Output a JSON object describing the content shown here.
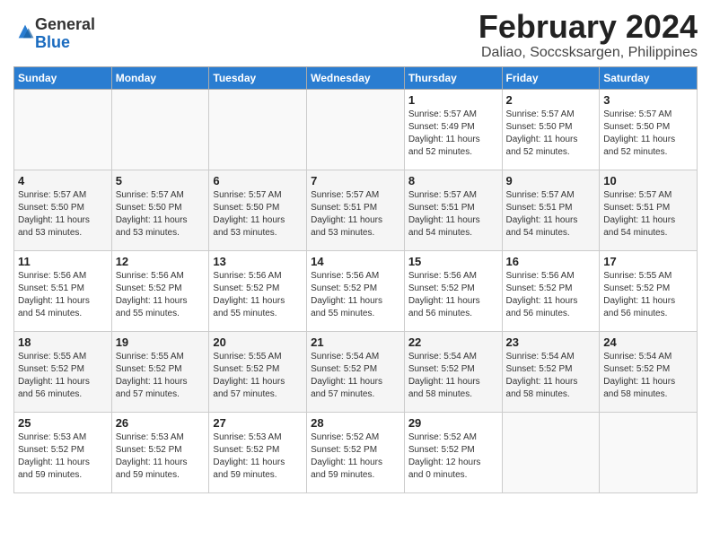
{
  "header": {
    "logo_general": "General",
    "logo_blue": "Blue",
    "month": "February 2024",
    "location": "Daliao, Soccsksargen, Philippines"
  },
  "columns": [
    "Sunday",
    "Monday",
    "Tuesday",
    "Wednesday",
    "Thursday",
    "Friday",
    "Saturday"
  ],
  "weeks": [
    [
      {
        "day": "",
        "content": ""
      },
      {
        "day": "",
        "content": ""
      },
      {
        "day": "",
        "content": ""
      },
      {
        "day": "",
        "content": ""
      },
      {
        "day": "1",
        "content": "Sunrise: 5:57 AM\nSunset: 5:49 PM\nDaylight: 11 hours\nand 52 minutes."
      },
      {
        "day": "2",
        "content": "Sunrise: 5:57 AM\nSunset: 5:50 PM\nDaylight: 11 hours\nand 52 minutes."
      },
      {
        "day": "3",
        "content": "Sunrise: 5:57 AM\nSunset: 5:50 PM\nDaylight: 11 hours\nand 52 minutes."
      }
    ],
    [
      {
        "day": "4",
        "content": "Sunrise: 5:57 AM\nSunset: 5:50 PM\nDaylight: 11 hours\nand 53 minutes."
      },
      {
        "day": "5",
        "content": "Sunrise: 5:57 AM\nSunset: 5:50 PM\nDaylight: 11 hours\nand 53 minutes."
      },
      {
        "day": "6",
        "content": "Sunrise: 5:57 AM\nSunset: 5:50 PM\nDaylight: 11 hours\nand 53 minutes."
      },
      {
        "day": "7",
        "content": "Sunrise: 5:57 AM\nSunset: 5:51 PM\nDaylight: 11 hours\nand 53 minutes."
      },
      {
        "day": "8",
        "content": "Sunrise: 5:57 AM\nSunset: 5:51 PM\nDaylight: 11 hours\nand 54 minutes."
      },
      {
        "day": "9",
        "content": "Sunrise: 5:57 AM\nSunset: 5:51 PM\nDaylight: 11 hours\nand 54 minutes."
      },
      {
        "day": "10",
        "content": "Sunrise: 5:57 AM\nSunset: 5:51 PM\nDaylight: 11 hours\nand 54 minutes."
      }
    ],
    [
      {
        "day": "11",
        "content": "Sunrise: 5:56 AM\nSunset: 5:51 PM\nDaylight: 11 hours\nand 54 minutes."
      },
      {
        "day": "12",
        "content": "Sunrise: 5:56 AM\nSunset: 5:52 PM\nDaylight: 11 hours\nand 55 minutes."
      },
      {
        "day": "13",
        "content": "Sunrise: 5:56 AM\nSunset: 5:52 PM\nDaylight: 11 hours\nand 55 minutes."
      },
      {
        "day": "14",
        "content": "Sunrise: 5:56 AM\nSunset: 5:52 PM\nDaylight: 11 hours\nand 55 minutes."
      },
      {
        "day": "15",
        "content": "Sunrise: 5:56 AM\nSunset: 5:52 PM\nDaylight: 11 hours\nand 56 minutes."
      },
      {
        "day": "16",
        "content": "Sunrise: 5:56 AM\nSunset: 5:52 PM\nDaylight: 11 hours\nand 56 minutes."
      },
      {
        "day": "17",
        "content": "Sunrise: 5:55 AM\nSunset: 5:52 PM\nDaylight: 11 hours\nand 56 minutes."
      }
    ],
    [
      {
        "day": "18",
        "content": "Sunrise: 5:55 AM\nSunset: 5:52 PM\nDaylight: 11 hours\nand 56 minutes."
      },
      {
        "day": "19",
        "content": "Sunrise: 5:55 AM\nSunset: 5:52 PM\nDaylight: 11 hours\nand 57 minutes."
      },
      {
        "day": "20",
        "content": "Sunrise: 5:55 AM\nSunset: 5:52 PM\nDaylight: 11 hours\nand 57 minutes."
      },
      {
        "day": "21",
        "content": "Sunrise: 5:54 AM\nSunset: 5:52 PM\nDaylight: 11 hours\nand 57 minutes."
      },
      {
        "day": "22",
        "content": "Sunrise: 5:54 AM\nSunset: 5:52 PM\nDaylight: 11 hours\nand 58 minutes."
      },
      {
        "day": "23",
        "content": "Sunrise: 5:54 AM\nSunset: 5:52 PM\nDaylight: 11 hours\nand 58 minutes."
      },
      {
        "day": "24",
        "content": "Sunrise: 5:54 AM\nSunset: 5:52 PM\nDaylight: 11 hours\nand 58 minutes."
      }
    ],
    [
      {
        "day": "25",
        "content": "Sunrise: 5:53 AM\nSunset: 5:52 PM\nDaylight: 11 hours\nand 59 minutes."
      },
      {
        "day": "26",
        "content": "Sunrise: 5:53 AM\nSunset: 5:52 PM\nDaylight: 11 hours\nand 59 minutes."
      },
      {
        "day": "27",
        "content": "Sunrise: 5:53 AM\nSunset: 5:52 PM\nDaylight: 11 hours\nand 59 minutes."
      },
      {
        "day": "28",
        "content": "Sunrise: 5:52 AM\nSunset: 5:52 PM\nDaylight: 11 hours\nand 59 minutes."
      },
      {
        "day": "29",
        "content": "Sunrise: 5:52 AM\nSunset: 5:52 PM\nDaylight: 12 hours\nand 0 minutes."
      },
      {
        "day": "",
        "content": ""
      },
      {
        "day": "",
        "content": ""
      }
    ]
  ]
}
